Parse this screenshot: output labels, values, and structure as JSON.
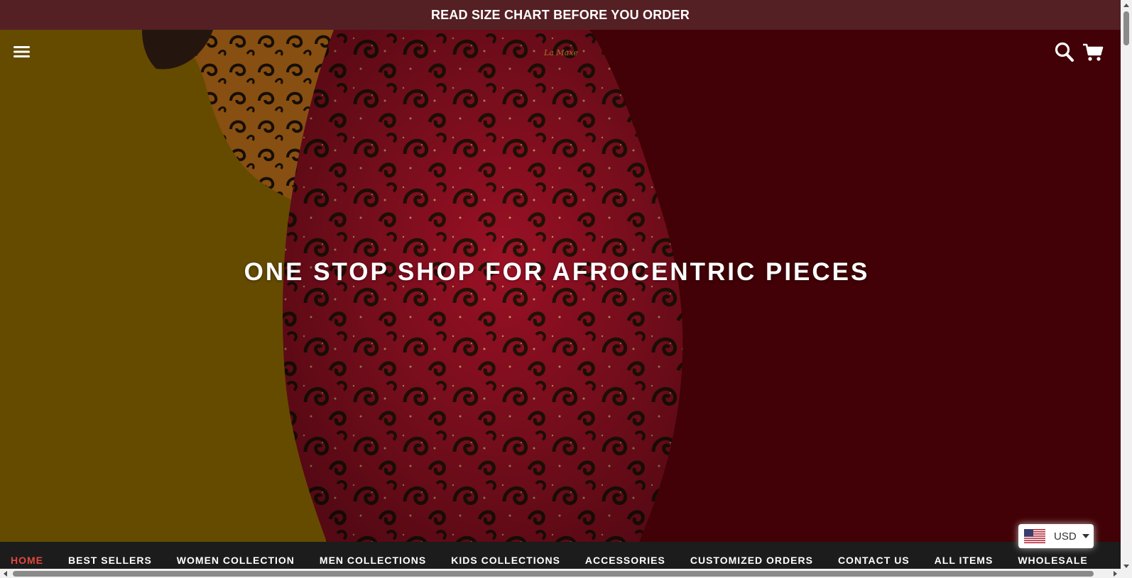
{
  "announcement": {
    "text": "READ SIZE CHART BEFORE YOU ORDER"
  },
  "header": {
    "menu_icon": "hamburger-menu-icon",
    "logo_text": "La Maxe",
    "search_icon": "search-icon",
    "cart_icon": "cart-icon"
  },
  "hero": {
    "title": "ONE STOP SHOP FOR AFROCENTRIC PIECES",
    "colors": {
      "left_bg": "#7a5a00",
      "right_bg": "#4a0207",
      "fabric": "#b0142a"
    }
  },
  "nav": {
    "items": [
      {
        "label": "HOME",
        "active": true
      },
      {
        "label": "BEST SELLERS"
      },
      {
        "label": "WOMEN COLLECTION"
      },
      {
        "label": "MEN COLLECTIONS"
      },
      {
        "label": "KIDS COLLECTIONS"
      },
      {
        "label": "ACCESSORIES"
      },
      {
        "label": "CUSTOMIZED ORDERS"
      },
      {
        "label": "CONTACT US"
      },
      {
        "label": "ALL ITEMS"
      },
      {
        "label": "WHOLESALE"
      }
    ],
    "active_color": "#e5473c"
  },
  "currency": {
    "code": "USD",
    "flag_icon": "us-flag-icon"
  }
}
